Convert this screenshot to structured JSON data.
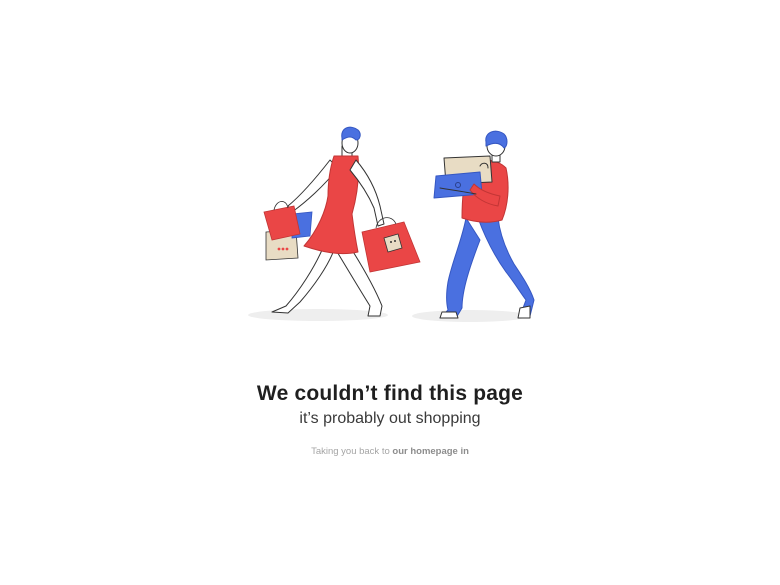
{
  "error": {
    "title": "We couldn’t find this page",
    "subtitle": "it’s probably out shopping",
    "redirect_prefix": "Taking you back to ",
    "redirect_link": "our homepage in"
  },
  "illustration": {
    "subject": "woman-with-shopping-bags-and-man-carrying-boxes",
    "colors": {
      "red": "#ea4646",
      "blue": "#4a70e0",
      "beige": "#e8dcc4",
      "shadow": "#eeeeee",
      "outline": "#333333"
    }
  }
}
